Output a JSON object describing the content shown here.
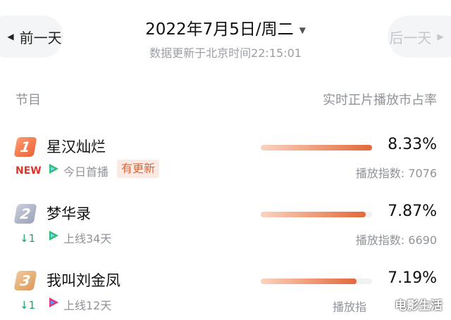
{
  "header": {
    "prev_label": "前一天",
    "next_label": "后一天",
    "date": "2022年7月5日/周二",
    "update_time": "数据更新于北京时间22:15:01"
  },
  "columns": {
    "program": "节目",
    "share": "实时正片播放市占率"
  },
  "rows": [
    {
      "rank": "1",
      "title": "星汉灿烂",
      "status_badge": "NEW",
      "platform_icon": "tencent-video-icon",
      "platform_color": "#2fbf71",
      "sub": "今日首播",
      "tag": "有更新",
      "share_pct": "8.33%",
      "share_value": 8.33,
      "index_text": "播放指数: 7076"
    },
    {
      "rank": "2",
      "title": "梦华录",
      "status_badge": "↓1",
      "platform_icon": "tencent-video-icon",
      "platform_color": "#2fbf71",
      "sub": "上线34天",
      "tag": "",
      "share_pct": "7.87%",
      "share_value": 7.87,
      "index_text": "播放指数: 6690"
    },
    {
      "rank": "3",
      "title": "我叫刘金凤",
      "status_badge": "↓1",
      "platform_icon": "youku-icon",
      "platform_color": "#e8337a",
      "sub": "上线12天",
      "tag": "",
      "share_pct": "7.19%",
      "share_value": 7.19,
      "index_text": "播放指"
    }
  ],
  "watermark": "电影生活",
  "colors": {
    "accent": "#e3683a",
    "new_badge": "#e1352b",
    "down_badge": "#1fa46a"
  }
}
